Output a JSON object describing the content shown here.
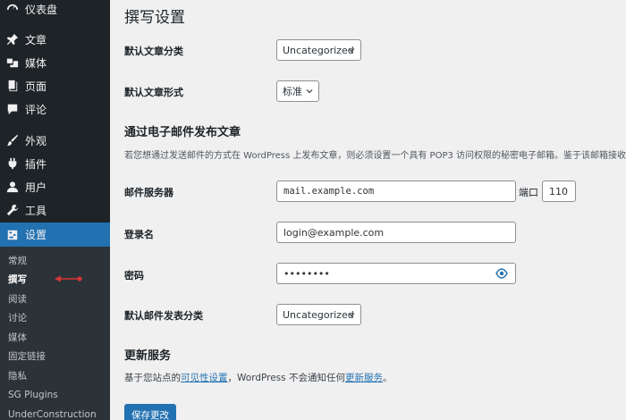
{
  "sidebar": {
    "items": [
      {
        "label": "仪表盘",
        "icon": "dashboard-icon"
      },
      {
        "label": "文章",
        "icon": "pin-icon"
      },
      {
        "label": "媒体",
        "icon": "media-icon"
      },
      {
        "label": "页面",
        "icon": "page-icon"
      },
      {
        "label": "评论",
        "icon": "comment-icon"
      },
      {
        "label": "外观",
        "icon": "brush-icon"
      },
      {
        "label": "插件",
        "icon": "plugin-icon"
      },
      {
        "label": "用户",
        "icon": "user-icon"
      },
      {
        "label": "工具",
        "icon": "wrench-icon"
      },
      {
        "label": "设置",
        "icon": "settings-icon"
      }
    ],
    "submenu": [
      "常规",
      "撰写",
      "阅读",
      "讨论",
      "媒体",
      "固定链接",
      "隐私",
      "SG Plugins",
      "UnderConstruction"
    ],
    "active_submenu": "撰写",
    "accent_color": "#2271b1",
    "annotation_color": "#d63638"
  },
  "page": {
    "title": "撰写设置",
    "default_category_label": "默认文章分类",
    "default_category_value": "Uncategorized",
    "default_format_label": "默认文章形式",
    "default_format_value": "标准",
    "post_via_email_heading": "通过电子邮件发布文章",
    "post_via_email_desc": "若您想通过发送邮件的方式在 WordPress 上发布文章，则必须设置一个具有 POP3 访问权限的秘密电子邮箱。鉴于该邮箱接收到",
    "mail_server_label": "邮件服务器",
    "mail_server_value": "mail.example.com",
    "port_label": "端口",
    "port_value": "110",
    "login_label": "登录名",
    "login_value": "login@example.com",
    "password_label": "密码",
    "password_value": "••••••••",
    "mail_category_label": "默认邮件发表分类",
    "mail_category_value": "Uncategorized",
    "update_services_heading": "更新服务",
    "update_desc_prefix": "基于您站点的",
    "update_desc_link1": "可见性设置",
    "update_desc_middle": "，WordPress 不会通知任何",
    "update_desc_link2": "更新服务",
    "update_desc_suffix": "。",
    "save_button": "保存更改"
  }
}
